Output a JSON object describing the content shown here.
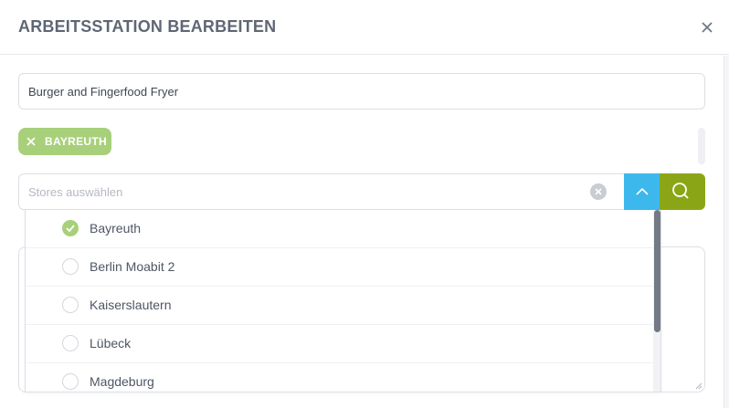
{
  "modal": {
    "title": "ARBEITSSTATION BEARBEITEN"
  },
  "name_field": {
    "value": "Burger and Fingerfood Fryer"
  },
  "selected_tags": [
    {
      "label": "BAYREUTH"
    }
  ],
  "store_select": {
    "placeholder": "Stores auswählen",
    "options": [
      {
        "label": "Bayreuth",
        "checked": true
      },
      {
        "label": "Berlin Moabit 2",
        "checked": false
      },
      {
        "label": "Kaiserslautern",
        "checked": false
      },
      {
        "label": "Lübeck",
        "checked": false
      },
      {
        "label": "Magdeburg",
        "checked": false
      }
    ]
  },
  "icons": {
    "close": "close-icon",
    "tag_remove": "x-icon",
    "clear": "clear-circle-icon",
    "toggle": "chevron-up-icon",
    "search": "search-icon",
    "checked": "check-circle-icon"
  },
  "colors": {
    "chip_green": "#a8d07a",
    "toggle_blue": "#3db8ec",
    "search_olive": "#8aa616",
    "title_gray": "#5f6775"
  }
}
